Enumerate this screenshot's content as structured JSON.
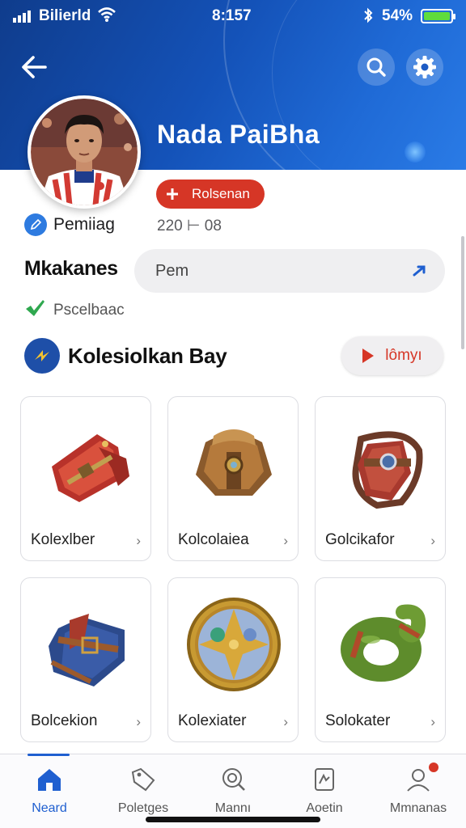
{
  "status_bar": {
    "carrier": "Bilierld",
    "time": "8:157",
    "battery": "54%",
    "battery_level": 0.9,
    "icons": [
      "signal-icon",
      "wifi-icon",
      "bluetooth-icon",
      "battery-icon"
    ]
  },
  "header": {
    "back_icon": "back-arrow-icon",
    "search_icon": "search-icon",
    "settings_icon": "gear-icon",
    "profile_name": "Nada PaiBha"
  },
  "profile": {
    "badge_label": "Rolsenan",
    "badge_icon": "plus-icon",
    "stat_value": "220 ⊢ 08",
    "verified_label": "Pemiiag",
    "section_label": "Mkakanes",
    "input_value": "Pem",
    "check_label": "Pscelbaac"
  },
  "collection": {
    "title": "Kolesiolkan Bay",
    "play_label": "lômyı",
    "items": [
      {
        "name": "Kolexlber",
        "icon": "red-scarf-icon"
      },
      {
        "name": "Kolcolaiea",
        "icon": "leather-shoulder-armor-icon"
      },
      {
        "name": "Golcikafor",
        "icon": "red-gauntlet-icon"
      },
      {
        "name": "Bolcekion",
        "icon": "blue-vest-icon"
      },
      {
        "name": "Kolexiater",
        "icon": "golden-shield-icon"
      },
      {
        "name": "Solokater",
        "icon": "green-ring-icon"
      }
    ]
  },
  "bottom_nav": {
    "items": [
      {
        "label": "Neard",
        "icon": "home-icon",
        "active": true
      },
      {
        "label": "Poletges",
        "icon": "tag-icon",
        "active": false
      },
      {
        "label": "Mannı",
        "icon": "magnifier-icon",
        "active": false
      },
      {
        "label": "Aoetin",
        "icon": "document-icon",
        "active": false
      },
      {
        "label": "Mmnanas",
        "icon": "profile-icon",
        "active": false
      }
    ]
  },
  "colors": {
    "header_blue": "#1452b8",
    "accent_red": "#d63626",
    "active_blue": "#1f5fd0"
  }
}
